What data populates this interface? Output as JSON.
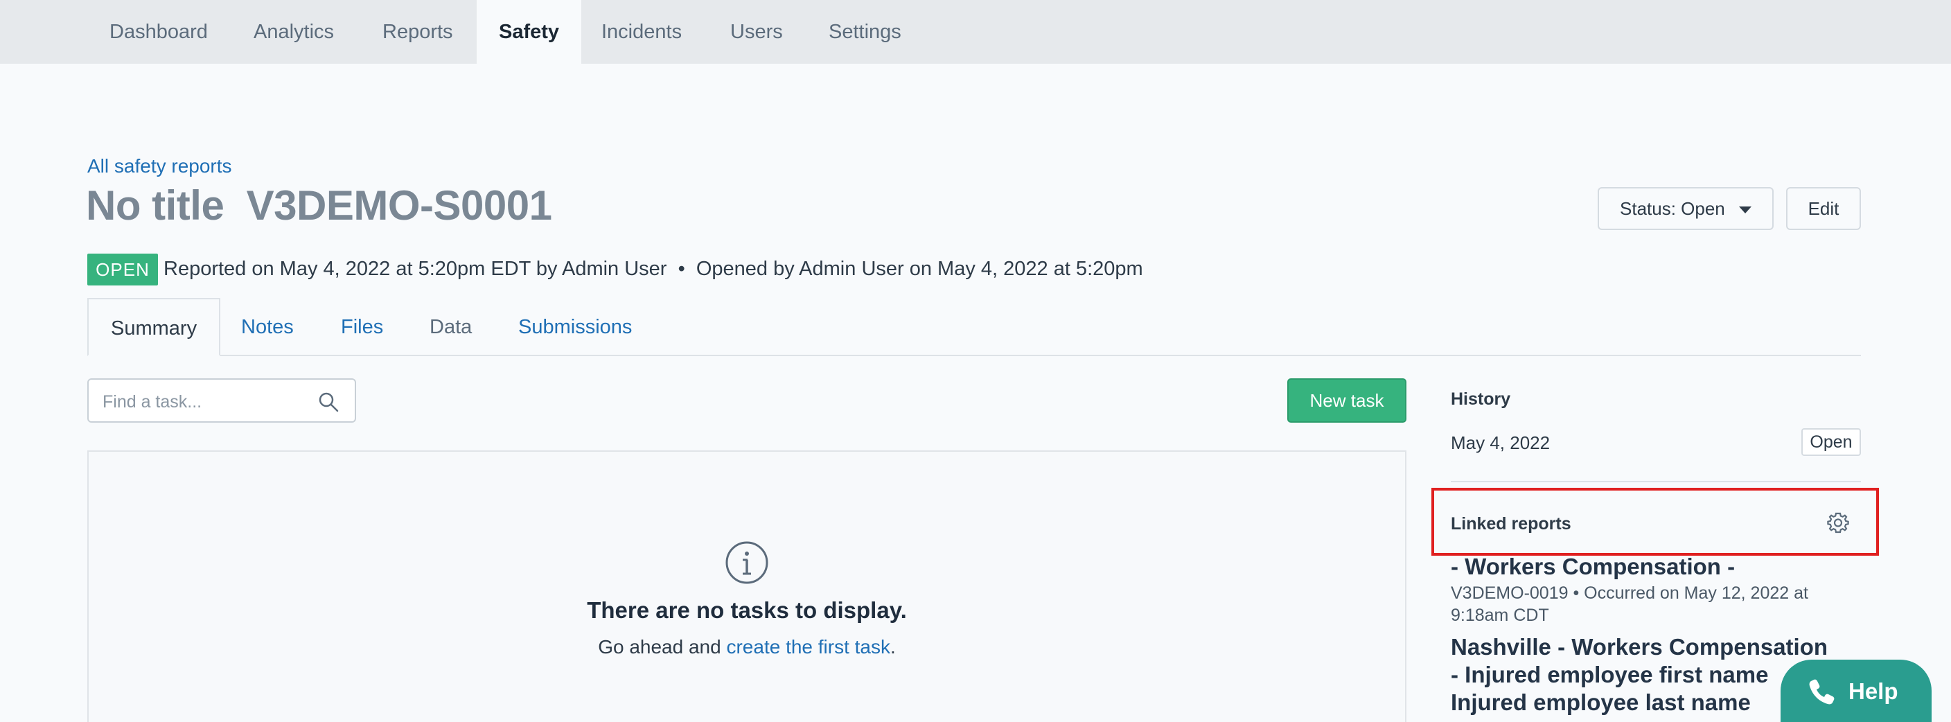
{
  "nav": {
    "tabs": [
      {
        "label": "Dashboard"
      },
      {
        "label": "Analytics"
      },
      {
        "label": "Reports"
      },
      {
        "label": "Safety"
      },
      {
        "label": "Incidents"
      },
      {
        "label": "Users"
      },
      {
        "label": "Settings"
      }
    ],
    "active": "Safety"
  },
  "breadcrumb": "All safety reports",
  "report": {
    "title": "No title  V3DEMO-S0001",
    "status_button": "Status: Open",
    "edit_button": "Edit",
    "badge": "OPEN",
    "meta": "Reported on May 4, 2022 at 5:20pm EDT by Admin User  •  Opened by Admin User on May 4, 2022 at 5:20pm"
  },
  "subtabs": [
    {
      "label": "Summary"
    },
    {
      "label": "Notes"
    },
    {
      "label": "Files"
    },
    {
      "label": "Data"
    },
    {
      "label": "Submissions"
    }
  ],
  "tasks": {
    "search_placeholder": "Find a task...",
    "new_task_button": "New task",
    "empty_title": "There are no tasks to display.",
    "empty_prefix": "Go ahead and ",
    "empty_link": "create the first task",
    "empty_suffix": "."
  },
  "sidebar": {
    "history_heading": "History",
    "history_date": "May 4, 2022",
    "history_status": "Open",
    "linked_heading": "Linked reports",
    "linked": [
      {
        "title": "- Workers Compensation -",
        "meta": "V3DEMO-0019  •  Occurred on May 12, 2022 at 9:18am CDT"
      },
      {
        "title": "Nashville - Workers Compensation - Injured employee first name Injured employee last name"
      }
    ]
  },
  "help_button": "Help",
  "colors": {
    "accent_green": "#36b37e",
    "link_blue": "#1f6fb5",
    "help_teal": "#2a9d8f",
    "highlight_red": "#e02020"
  }
}
